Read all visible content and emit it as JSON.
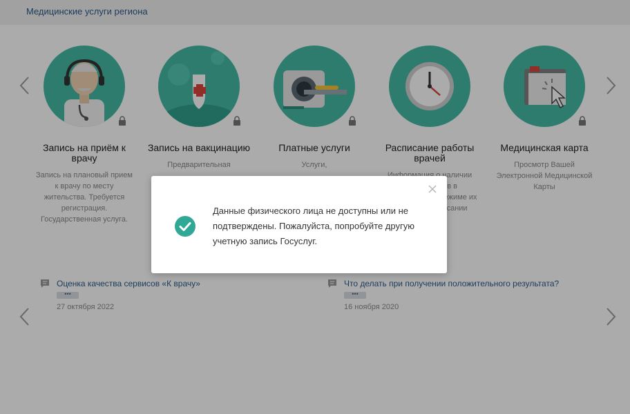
{
  "header": {
    "title": "Медицинские услуги региона"
  },
  "colors": {
    "accent": "#43b9a5",
    "link": "#2a5a8a",
    "overlay": "rgba(0,0,0,0.33)"
  },
  "services": [
    {
      "title": "Запись на приём к врачу",
      "description": "Запись на плановый прием к врачу по месту жительства. Требуется регистрация. Государственная услуга.",
      "icon": "doctor-icon"
    },
    {
      "title": "Запись на вакцинацию",
      "description": "Предварительная",
      "icon": "vaccination-icon"
    },
    {
      "title": "Платные услуги",
      "description": "Услуги,",
      "icon": "mri-scanner-icon"
    },
    {
      "title": "Расписание работы врачей",
      "description": "Информация о наличии специалистов в поликлиниках и режиме их работы в расписании",
      "icon": "clock-icon"
    },
    {
      "title": "Медицинская карта",
      "description": "Просмотр Вашей Электронной Медицинской Карты",
      "icon": "medical-card-icon"
    }
  ],
  "news": [
    {
      "title": "Оценка качества сервисов «К врачу»",
      "more": "•••",
      "date": "27 октября 2022"
    },
    {
      "title": "Что делать при получении положительного результата?",
      "more": "•••",
      "date": "16 ноября 2020"
    }
  ],
  "modal": {
    "message": "Данные физического лица не доступны или не подтверждены. Пожалуйста, попробуйте другую учетную запись Госуслуг."
  }
}
